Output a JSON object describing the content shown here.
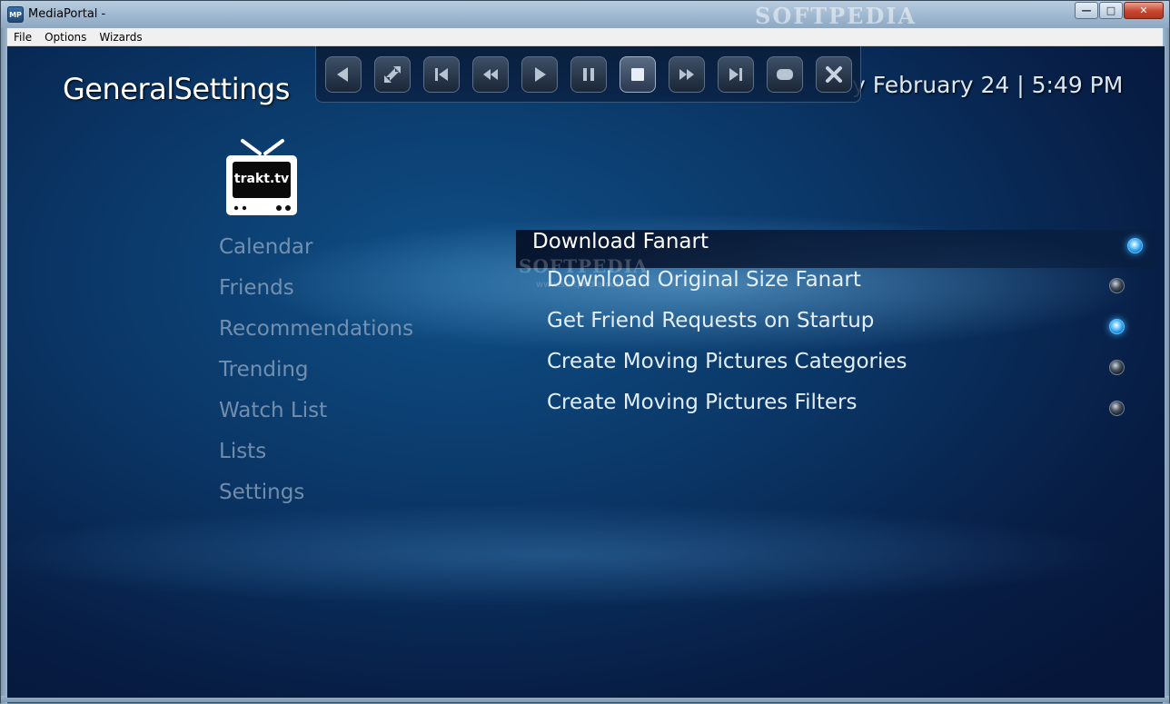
{
  "window": {
    "app_icon": "MP",
    "title": "MediaPortal -",
    "watermark": "SOFTPEDIA",
    "controls": {
      "minimize": "—",
      "maximize": "□",
      "close": "✕"
    }
  },
  "menubar": [
    "File",
    "Options",
    "Wizards"
  ],
  "header": {
    "title": "GeneralSettings",
    "clock": "y February 24 | 5:49 PM"
  },
  "osd": {
    "buttons": [
      {
        "name": "back",
        "icon": "triangle-left-icon"
      },
      {
        "name": "swap",
        "icon": "swap-icon"
      },
      {
        "name": "previous",
        "icon": "skip-previous-icon"
      },
      {
        "name": "rewind",
        "icon": "rewind-icon"
      },
      {
        "name": "play",
        "icon": "play-icon"
      },
      {
        "name": "pause",
        "icon": "pause-icon"
      },
      {
        "name": "stop",
        "icon": "stop-icon",
        "active": true
      },
      {
        "name": "fast-forward",
        "icon": "fast-forward-icon"
      },
      {
        "name": "next",
        "icon": "skip-next-icon"
      },
      {
        "name": "record",
        "icon": "rounded-square-icon"
      },
      {
        "name": "close",
        "icon": "close-icon"
      }
    ]
  },
  "logo": {
    "text": "trakt.tv"
  },
  "sidebar": {
    "items": [
      "Calendar",
      "Friends",
      "Recommendations",
      "Trending",
      "Watch List",
      "Lists",
      "Settings"
    ]
  },
  "settings": {
    "options": [
      {
        "label": "Download Fanart",
        "enabled": true,
        "focused": true
      },
      {
        "label": "Download Original Size Fanart",
        "enabled": false
      },
      {
        "label": "Get Friend Requests on Startup",
        "enabled": true
      },
      {
        "label": "Create Moving Pictures Categories",
        "enabled": false
      },
      {
        "label": "Create Moving Pictures Filters",
        "enabled": false
      }
    ]
  },
  "watermark": {
    "text": "SOFTPEDIA",
    "sub": "www.softpedia.com"
  },
  "colors": {
    "accent": "#3ab0ff",
    "background": "#0a3565",
    "focus_bar": "#08163a"
  }
}
